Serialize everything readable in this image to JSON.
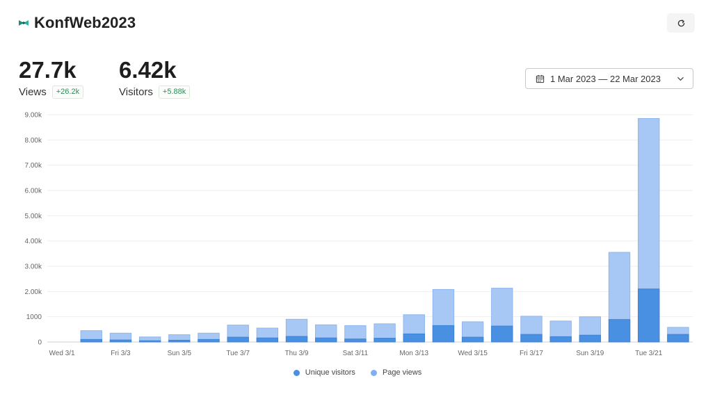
{
  "header": {
    "title": "KonfWeb2023",
    "logo_icon": "konfweb-logo-icon",
    "refresh_icon": "refresh-icon"
  },
  "metrics": [
    {
      "value": "27.7k",
      "label": "Views",
      "change": "+26.2k"
    },
    {
      "value": "6.42k",
      "label": "Visitors",
      "change": "+5.88k"
    }
  ],
  "date_range": {
    "label": "1 Mar 2023 — 22 Mar 2023",
    "icon": "calendar-icon",
    "dropdown_icon": "chevron-down-icon"
  },
  "colors": {
    "unique": "#4a90e2",
    "pageviews": "#a7c8f5",
    "accent_positive": "#2e8b57"
  },
  "chart_data": {
    "type": "bar",
    "stacked": "overlay",
    "categories": [
      "Wed 3/1",
      "Thu 3/2",
      "Fri 3/3",
      "Sat 3/4",
      "Sun 3/5",
      "Mon 3/6",
      "Tue 3/7",
      "Wed 3/8",
      "Thu 3/9",
      "Fri 3/10",
      "Sat 3/11",
      "Sun 3/12",
      "Mon 3/13",
      "Tue 3/14",
      "Wed 3/15",
      "Thu 3/16",
      "Fri 3/17",
      "Sat 3/18",
      "Sun 3/19",
      "Mon 3/20",
      "Tue 3/21",
      "Wed 3/22"
    ],
    "x_tick_labels": [
      "Wed 3/1",
      "Fri 3/3",
      "Sun 3/5",
      "Tue 3/7",
      "Thu 3/9",
      "Sat 3/11",
      "Mon 3/13",
      "Wed 3/15",
      "Fri 3/17",
      "Sun 3/19",
      "Tue 3/21"
    ],
    "series": [
      {
        "name": "Unique visitors",
        "values": [
          0,
          100,
          80,
          50,
          70,
          100,
          190,
          160,
          220,
          160,
          120,
          150,
          320,
          650,
          190,
          630,
          300,
          210,
          270,
          890,
          2100,
          300
        ]
      },
      {
        "name": "Page views",
        "values": [
          0,
          450,
          350,
          200,
          290,
          350,
          670,
          550,
          900,
          680,
          650,
          720,
          1080,
          2080,
          800,
          2130,
          1020,
          830,
          1000,
          3550,
          8850,
          580
        ]
      }
    ],
    "y_tick_labels": [
      "0",
      "1000",
      "2.00k",
      "3.00k",
      "4.00k",
      "5.00k",
      "6.00k",
      "7.00k",
      "8.00k",
      "9.00k"
    ],
    "ylim": [
      0,
      9000
    ],
    "grid": true,
    "legend": "bottom-center",
    "xlabel": "",
    "ylabel": "",
    "title": ""
  }
}
